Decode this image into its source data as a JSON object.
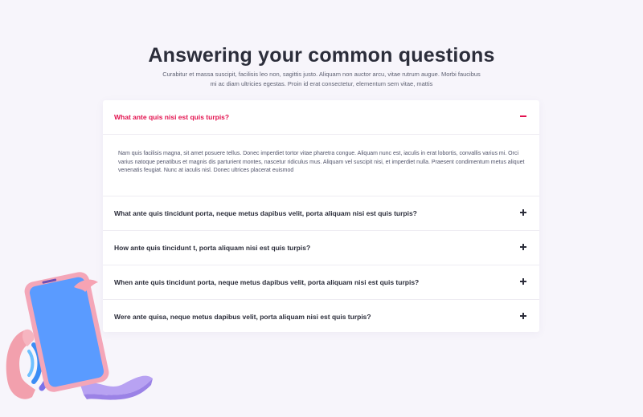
{
  "section": {
    "title": "Answering your common questions",
    "subtitle": "Curabitur et massa suscipit, facilisis leo non, sagittis justo. Aliquam non auctor arcu, vitae rutrum augue. Morbi faucibus mi ac diam ultricies egestas. Proin id erat consectetur, elementum sem vitae, mattis"
  },
  "faq": {
    "items": [
      {
        "question": "What ante quis nisi est quis turpis?",
        "answer": "Nam quis facilisis magna, sit amet posuere tellus. Donec imperdiet tortor vitae pharetra congue. Aliquam nunc est, iaculis in erat lobortis, convallis varius mi. Orci varius natoque penatibus et magnis dis parturient montes, nascetur ridiculus mus. Aliquam vel suscipit nisi, et imperdiet nulla. Praesent condimentum metus aliquet venenatis feugiat. Nunc at iaculis nisl. Donec ultrices placerat euismod",
        "expanded": true
      },
      {
        "question": "What ante quis tincidunt porta, neque metus dapibus velit, porta aliquam nisi est quis turpis?",
        "expanded": false
      },
      {
        "question": "How ante quis tincidunt t, porta aliquam nisi est quis turpis?",
        "expanded": false
      },
      {
        "question": "When ante quis tincidunt porta, neque metus dapibus velit, porta aliquam nisi est quis turpis?",
        "expanded": false
      },
      {
        "question": "Were ante quisa, neque metus dapibus velit, porta aliquam nisi est quis turpis?",
        "expanded": false
      }
    ]
  },
  "colors": {
    "accent": "#e3124f",
    "heading": "#2c2e3b",
    "background": "#f7f5fb",
    "card": "#ffffff"
  },
  "icons": {
    "collapse": "minus-icon",
    "expand": "plus-icon",
    "illustration": "phone-call-illustration"
  }
}
